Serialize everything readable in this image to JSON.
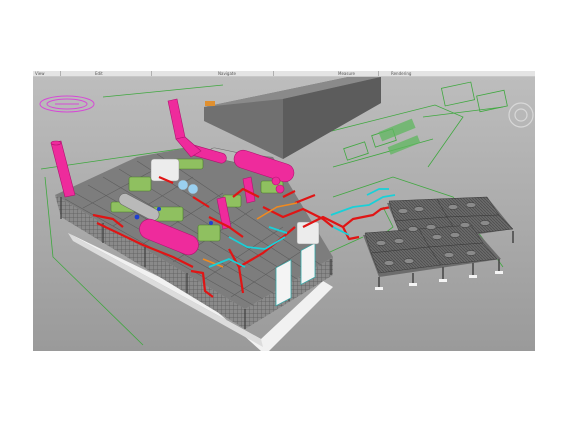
{
  "toolbar": {
    "items": [
      "View",
      "Edit",
      "Navigate",
      "Measure",
      "Rendering"
    ]
  },
  "viewport": {
    "background": "#a8a8a8",
    "colors": {
      "structure_frame": "#6e6e6e",
      "pipe_hot": "#e01515",
      "pipe_cold": "#19d0d8",
      "vessel": "#ee2b9c",
      "equipment": "#8fc060",
      "building": "#7a7a7a",
      "site_lines": "#3fa83f",
      "cooler": "#5e5e5e"
    }
  }
}
